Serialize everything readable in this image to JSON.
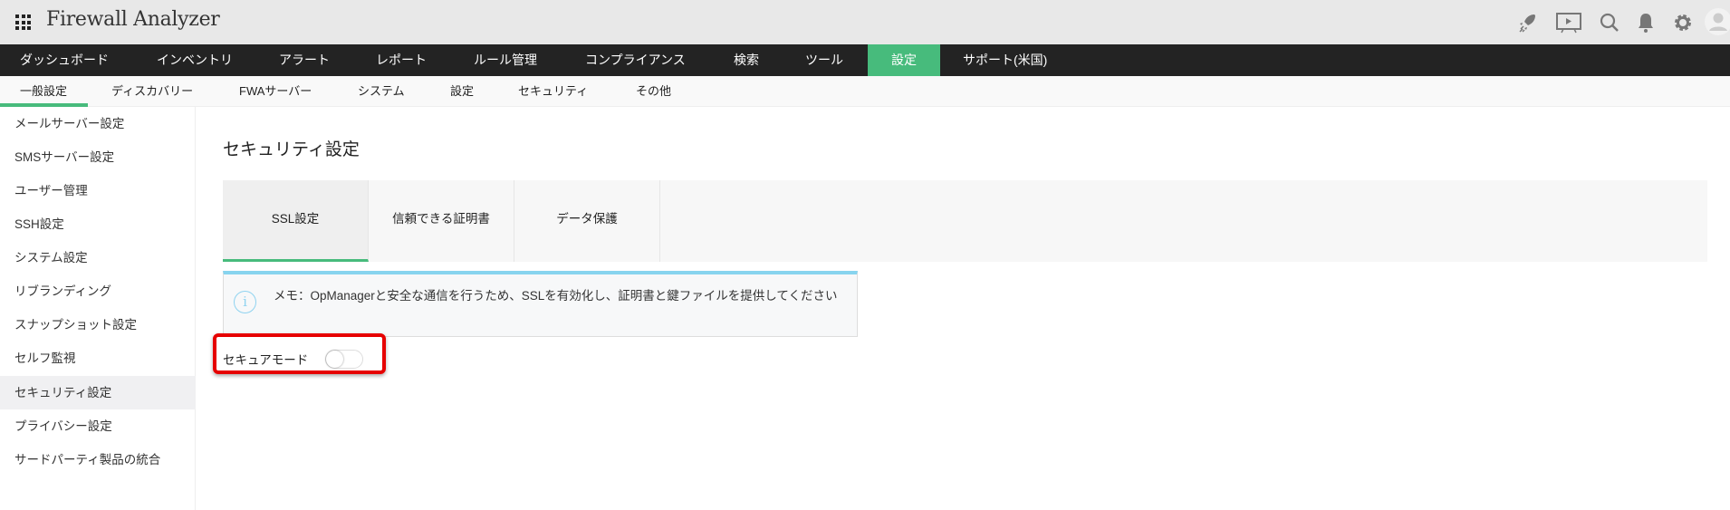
{
  "header": {
    "title": "Firewall Analyzer",
    "icons": [
      "apps-grid-icon",
      "rocket-icon",
      "presentation-icon",
      "search-icon",
      "bell-icon",
      "gear-icon",
      "avatar-icon"
    ]
  },
  "nav": {
    "items": [
      "ダッシュボード",
      "インベントリ",
      "アラート",
      "レポート",
      "ルール管理",
      "コンプライアンス",
      "検索",
      "ツール",
      "設定",
      "サポート(米国)"
    ],
    "active": "設定",
    "accent": "#47bb7c"
  },
  "subnav": {
    "items": [
      "一般設定",
      "ディスカバリー",
      "FWAサーバー",
      "システム",
      "設定",
      "セキュリティ",
      "その他"
    ],
    "active": "一般設定"
  },
  "sidebar": {
    "items": [
      "メールサーバー設定",
      "SMSサーバー設定",
      "ユーザー管理",
      "SSH設定",
      "システム設定",
      "リブランディング",
      "スナップショット設定",
      "セルフ監視",
      "セキュリティ設定",
      "プライバシー設定",
      "サードパーティ製品の統合"
    ],
    "active": "セキュリティ設定"
  },
  "main": {
    "title": "セキュリティ設定",
    "tabs": [
      "SSL設定",
      "信頼できる証明書",
      "データ保護"
    ],
    "active_tab": "SSL設定",
    "memo": "メモ：OpManagerと安全な通信を行うため、SSLを有効化し、証明書と鍵ファイルを提供してください",
    "secure_mode_label": "セキュアモード",
    "secure_mode_on": false
  }
}
